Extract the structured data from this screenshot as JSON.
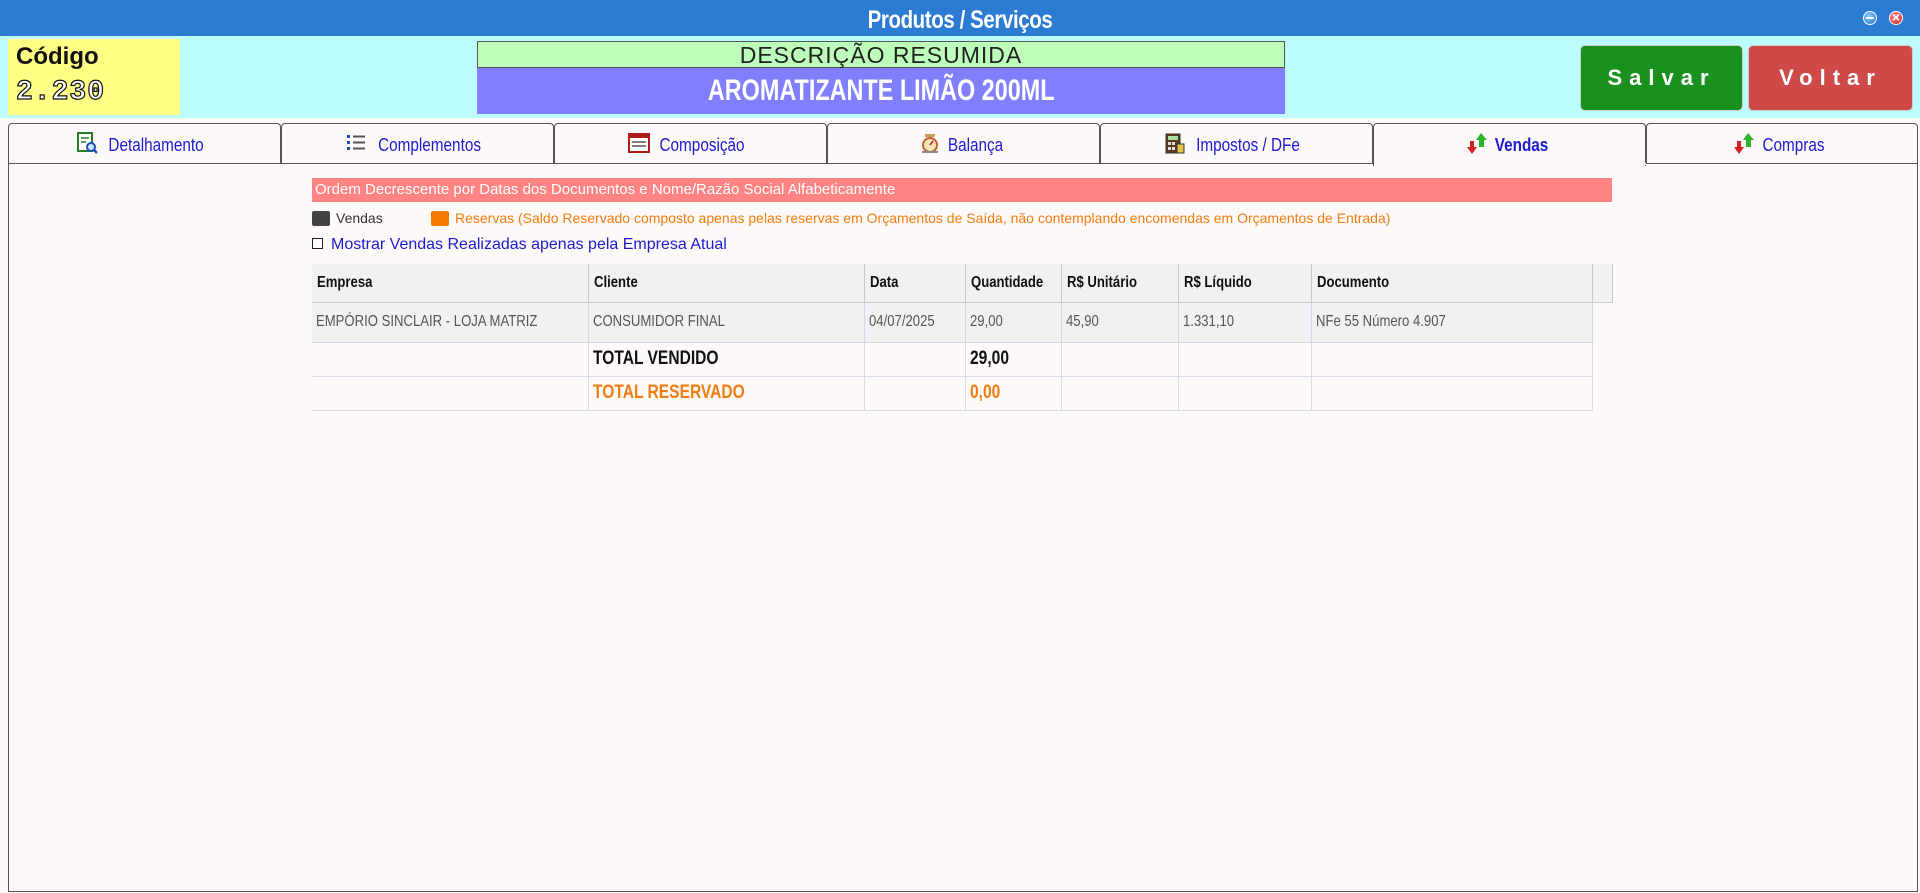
{
  "window": {
    "title": "Produtos / Serviços",
    "minimize_icon": "minimize-icon",
    "close_icon": "close-icon"
  },
  "product": {
    "code_label": "Código",
    "code_value": "2.230",
    "desc_label": "DESCRIÇÃO RESUMIDA",
    "desc_value": "AROMATIZANTE LIMÃO 200ML"
  },
  "actions": {
    "save_label": "Salvar",
    "back_label": "Voltar"
  },
  "tabs": [
    {
      "label": "Detalhamento",
      "icon": "search-document-icon"
    },
    {
      "label": "Complementos",
      "icon": "list-icon"
    },
    {
      "label": "Composição",
      "icon": "form-icon"
    },
    {
      "label": "Balança",
      "icon": "scale-icon"
    },
    {
      "label": "Impostos / DFe",
      "icon": "calculator-icon"
    },
    {
      "label": "Vendas",
      "icon": "up-down-arrows-icon",
      "active": true
    },
    {
      "label": "Compras",
      "icon": "up-down-arrows-icon"
    }
  ],
  "sales": {
    "sort_note": "Ordem Decrescente por Datas dos Documentos e Nome/Razão Social Alfabeticamente",
    "legend_sales": "Vendas",
    "legend_reserves": "Reservas (Saldo Reservado composto apenas pelas reservas em Orçamentos de Saída, não contemplando encomendas em Orçamentos de Entrada)",
    "checkbox_label": "Mostrar Vendas Realizadas apenas pela Empresa Atual",
    "checkbox_checked": false,
    "colors": {
      "sales": "#444444",
      "reserves": "#f57c00",
      "banner": "#ff8483"
    },
    "columns": [
      "Empresa",
      "Cliente",
      "Data",
      "Quantidade",
      "R$ Unitário",
      "R$ Líquido",
      "Documento"
    ],
    "rows": [
      [
        "EMPÓRIO SINCLAIR - LOJA MATRIZ",
        "CONSUMIDOR FINAL",
        "04/07/2025",
        "29,00",
        "45,90",
        "1.331,10",
        "NFe 55 Número 4.907"
      ]
    ],
    "total_sold_label": "TOTAL VENDIDO",
    "total_sold_value": "29,00",
    "total_reserved_label": "TOTAL RESERVADO",
    "total_reserved_value": "0,00"
  }
}
